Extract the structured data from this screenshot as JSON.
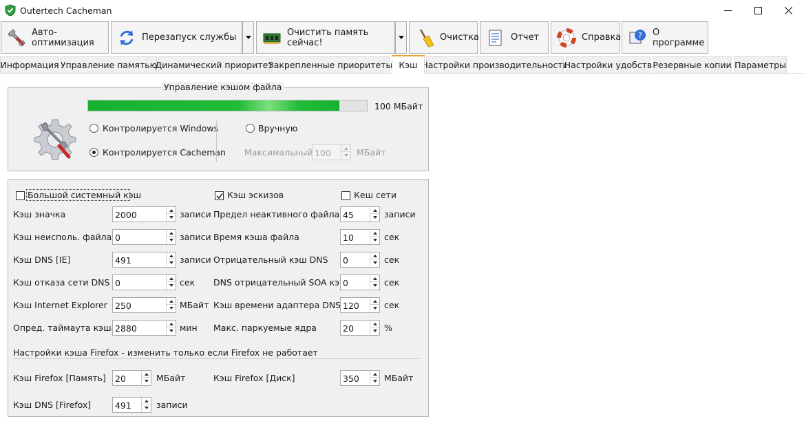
{
  "window": {
    "title": "Outertech Cacheman"
  },
  "toolbar": {
    "auto_optimize": "Авто-оптимизация",
    "restart_service": "Перезапуск службы",
    "free_memory": "Очистить память сейчас!",
    "cleanup": "Очистка",
    "report": "Отчет",
    "help": "Справка",
    "about": "О программе"
  },
  "tabs": [
    {
      "label": "Информация"
    },
    {
      "label": "Управление памятью"
    },
    {
      "label": "Динамический приоритет"
    },
    {
      "label": "Закрепленные приоритеты"
    },
    {
      "label": "Кэш",
      "active": true
    },
    {
      "label": "Настройки производительности"
    },
    {
      "label": "Настройки удобств"
    },
    {
      "label": "Резервные копии"
    },
    {
      "label": "Параметры"
    }
  ],
  "file_cache": {
    "title": "Управление кэшом файла",
    "progress_label": "100 МБайт",
    "progress_fraction": 0.9,
    "windows_controlled": "Контролируется Windows",
    "cacheman_controlled": "Контролируется Cacheman",
    "manual": "Вручную",
    "max_label": "Максимальный",
    "max_value": "100",
    "max_unit": "МБайт",
    "selected": "cacheman"
  },
  "cache_settings": {
    "large_system_cache": {
      "label": "Большой системный кэш",
      "checked": false
    },
    "thumbnail_cache": {
      "label": "Кэш эскизов",
      "checked": true
    },
    "network_cache": {
      "label": "Кеш сети",
      "checked": false
    },
    "left": [
      {
        "label": "Кэш значка",
        "value": "2000",
        "unit": "записи"
      },
      {
        "label": "Кэш неисполь. файла",
        "value": "0",
        "unit": "записи"
      },
      {
        "label": "Кэш DNS [IE]",
        "value": "491",
        "unit": "записи"
      },
      {
        "label": "Кэш отказа сети DNS",
        "value": "0",
        "unit": "сек"
      },
      {
        "label": "Кэш Internet Explorer",
        "value": "250",
        "unit": "МБайт"
      },
      {
        "label": "Опред. таймаута кэша",
        "value": "2880",
        "unit": "мин"
      }
    ],
    "right": [
      {
        "label": "Предел неактивного файла",
        "value": "45",
        "unit": "записи"
      },
      {
        "label": "Время кэша файла",
        "value": "10",
        "unit": "сек"
      },
      {
        "label": "Отрицательный кэш DNS",
        "value": "0",
        "unit": "сек"
      },
      {
        "label": "DNS отрицательный SOA кэш",
        "value": "0",
        "unit": "сек"
      },
      {
        "label": "Кэш времени адаптера DNS",
        "value": "120",
        "unit": "сек"
      },
      {
        "label": "Макс. паркуемые ядра",
        "value": "20",
        "unit": "%"
      }
    ],
    "firefox_heading": "Настройки кэша Firefox - изменить только если Firefox не работает",
    "firefox_memory": {
      "label": "Кэш Firefox [Память]",
      "value": "20",
      "unit": "МБайт"
    },
    "firefox_disk": {
      "label": "Кэш Firefox [Диск]",
      "value": "350",
      "unit": "МБайт"
    },
    "firefox_dns": {
      "label": "Кэш DNS [Firefox]",
      "value": "491",
      "unit": "записи"
    }
  },
  "colors": {
    "accent_tab": "#f0a030",
    "progress": "#22bb38",
    "panel": "#f0f0f0"
  }
}
